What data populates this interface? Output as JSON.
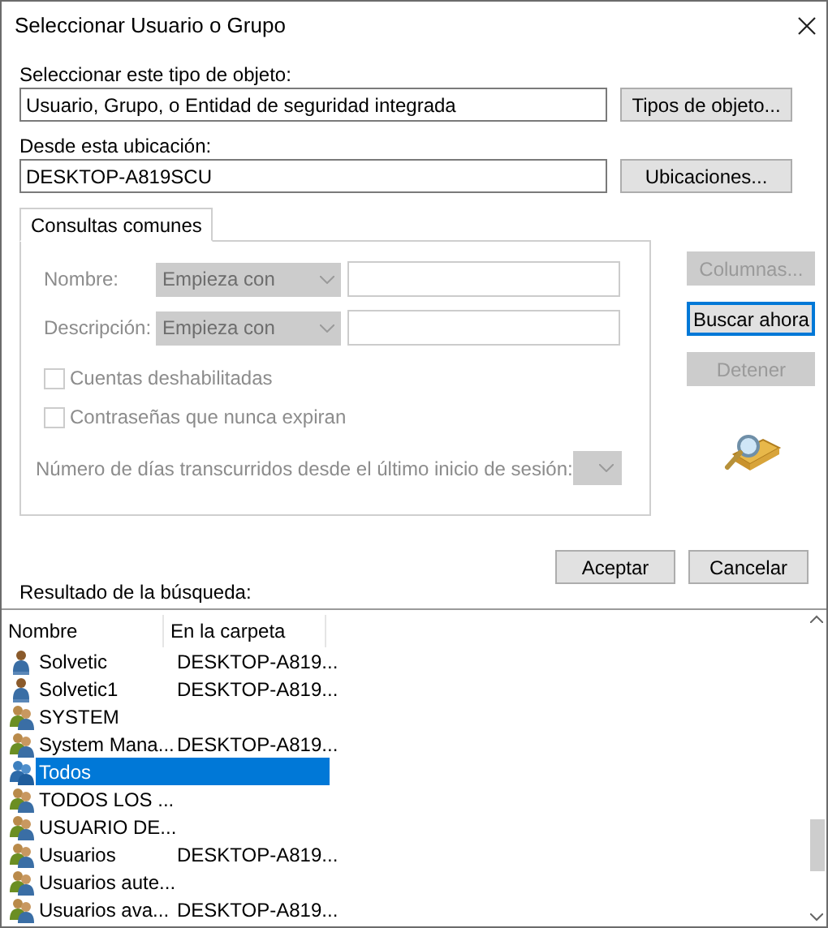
{
  "window": {
    "title": "Seleccionar Usuario o Grupo"
  },
  "object_type": {
    "label": "Seleccionar este tipo de objeto:",
    "value": "Usuario, Grupo, o Entidad de seguridad integrada",
    "button": "Tipos de objeto..."
  },
  "location": {
    "label": "Desde esta ubicación:",
    "value": "DESKTOP-A819SCU",
    "button": "Ubicaciones..."
  },
  "tabs": [
    {
      "label": "Consultas comunes",
      "selected": true
    }
  ],
  "query": {
    "disabled": true,
    "fields": [
      {
        "label": "Nombre:",
        "mode": "Empieza con"
      },
      {
        "label": "Descripción:",
        "mode": "Empieza con"
      }
    ],
    "checkboxes": [
      {
        "label": "Cuentas deshabilitadas",
        "checked": false
      },
      {
        "label": "Contraseñas que nunca expiran",
        "checked": false
      }
    ],
    "days_label": "Número de días transcurridos desde el último inicio de sesión:"
  },
  "side_buttons": [
    {
      "label": "Columnas...",
      "disabled": true,
      "focused": false
    },
    {
      "label": "Buscar ahora",
      "disabled": false,
      "focused": true
    },
    {
      "label": "Detener",
      "disabled": true,
      "focused": false
    }
  ],
  "dialog_buttons": [
    "Aceptar",
    "Cancelar"
  ],
  "results": {
    "label": "Resultado de la búsqueda:",
    "columns": [
      "Nombre",
      "En la carpeta"
    ],
    "rows": [
      {
        "kind": "user",
        "name": "Solvetic",
        "folder": "DESKTOP-A819...",
        "selected": false
      },
      {
        "kind": "user",
        "name": "Solvetic1",
        "folder": "DESKTOP-A819...",
        "selected": false
      },
      {
        "kind": "group",
        "name": "SYSTEM",
        "selected": false
      },
      {
        "kind": "group",
        "name": "System Mana...",
        "folder": "DESKTOP-A819...",
        "selected": false
      },
      {
        "kind": "group",
        "name": "Todos",
        "selected": true
      },
      {
        "kind": "group",
        "name": "TODOS LOS ...",
        "selected": false
      },
      {
        "kind": "group",
        "name": "USUARIO DE...",
        "selected": false
      },
      {
        "kind": "group",
        "name": "Usuarios",
        "folder": "DESKTOP-A819...",
        "selected": false
      },
      {
        "kind": "group",
        "name": "Usuarios aute...",
        "selected": false
      },
      {
        "kind": "group",
        "name": "Usuarios ava...",
        "folder": "DESKTOP-A819...",
        "selected": false
      }
    ]
  }
}
